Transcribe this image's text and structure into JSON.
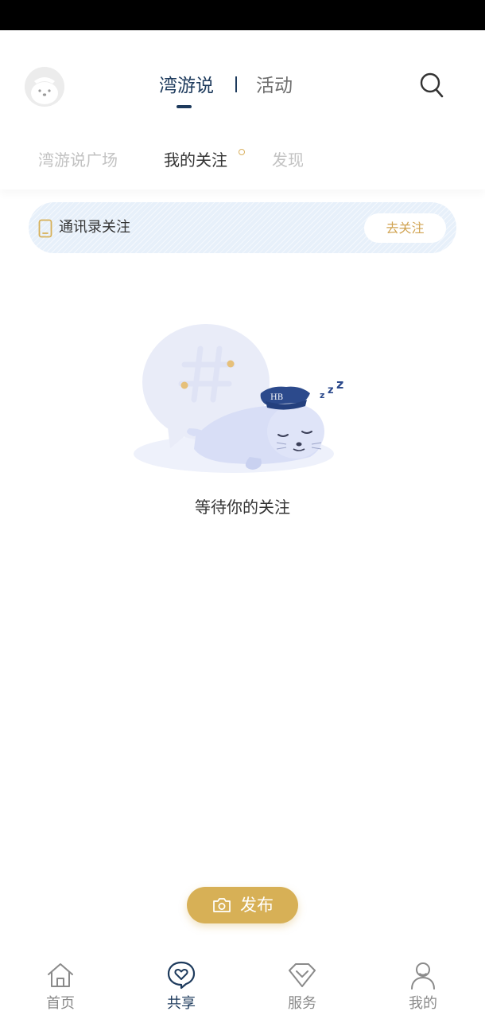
{
  "header": {
    "main_tabs": [
      {
        "label": "湾游说",
        "active": true
      },
      {
        "label": "活动",
        "active": false
      }
    ],
    "sub_tabs": [
      {
        "label": "湾游说广场",
        "active": false
      },
      {
        "label": "我的关注",
        "active": true,
        "badge_dot": true
      },
      {
        "label": "发现",
        "active": false
      }
    ],
    "search_icon": "search-icon",
    "avatar_icon": "seal-avatar"
  },
  "contacts_banner": {
    "icon": "phone-icon",
    "label": "通讯录关注",
    "button_label": "去关注"
  },
  "empty_state": {
    "illustration": "sleeping-seal-illustration",
    "message": "等待你的关注"
  },
  "publish": {
    "icon": "camera-icon",
    "label": "发布"
  },
  "bottom_nav": [
    {
      "label": "首页",
      "icon": "home-icon",
      "active": false
    },
    {
      "label": "共享",
      "icon": "share-heart-icon",
      "active": true
    },
    {
      "label": "服务",
      "icon": "diamond-icon",
      "active": false
    },
    {
      "label": "我的",
      "icon": "user-icon",
      "active": false
    }
  ],
  "colors": {
    "primary_navy": "#1d3a5c",
    "accent_gold": "#d7b056",
    "banner_bg": "#e7f0fa"
  }
}
